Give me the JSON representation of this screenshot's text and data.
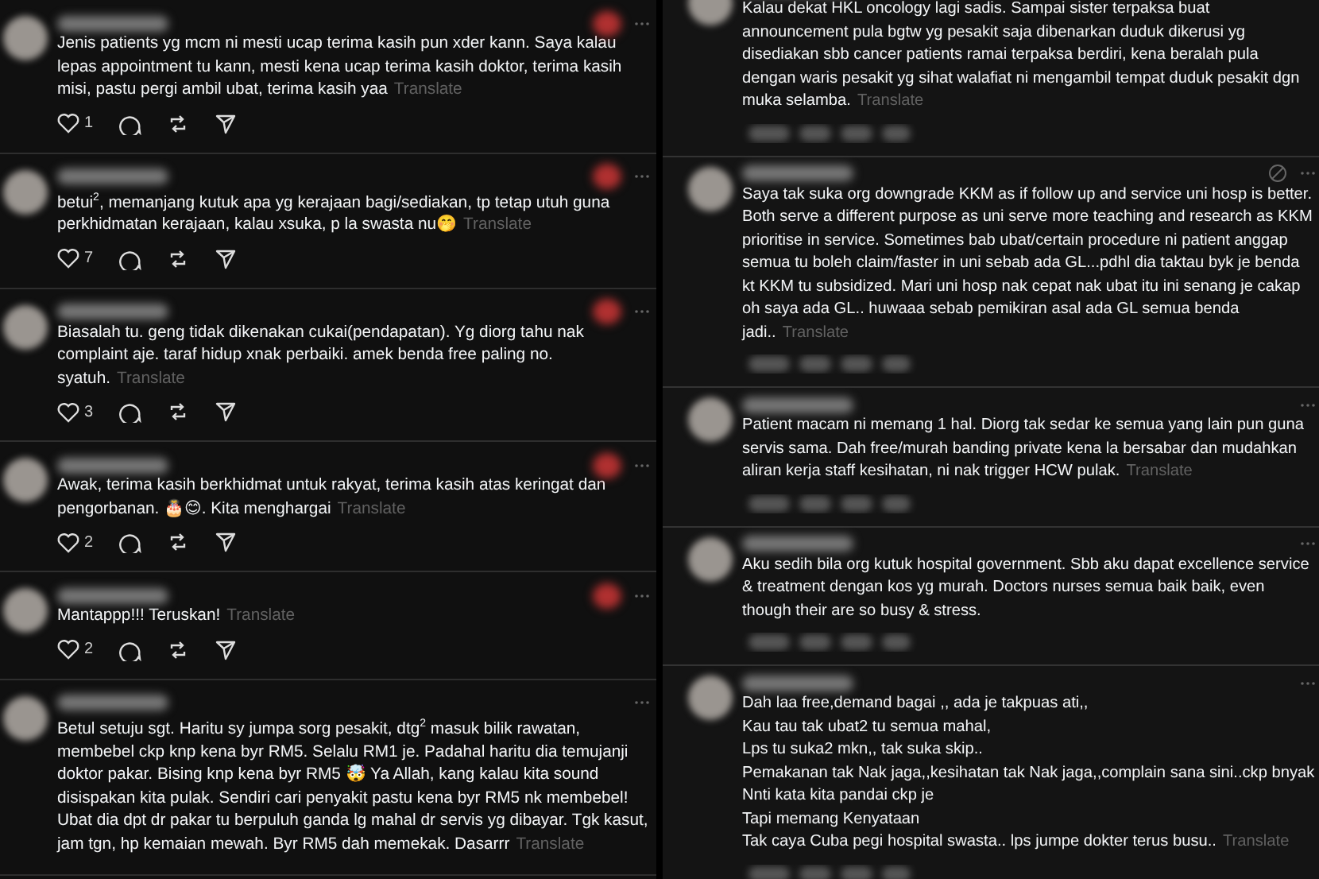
{
  "left_replies": [
    {
      "text": "Jenis patients yg mcm ni mesti ucap terima kasih pun xder kann. Saya kalau lepas appointment tu kann, mesti kena ucap terima kasih doktor, terima kasih misi, pastu pergi ambil ubat, terima kasih yaa",
      "translate": "Translate",
      "likes": "1",
      "author_liked": true
    },
    {
      "text": "betui$^{2}$, memanjang kutuk apa yg kerajaan bagi/sediakan, tp tetap utuh guna perkhidmatan kerajaan, kalau xsuka, p la swasta nu🤭",
      "translate": "Translate",
      "likes": "7",
      "author_liked": true
    },
    {
      "text": "Biasalah tu. geng tidak dikenakan cukai(pendapatan). Yg diorg tahu nak complaint aje. taraf hidup xnak perbaiki. amek benda free paling no. syatuh.",
      "translate": "Translate",
      "likes": "3",
      "author_liked": true
    },
    {
      "text": "Awak, terima kasih berkhidmat untuk rakyat, terima kasih atas keringat dan pengorbanan. 🎂😊. Kita menghargai",
      "translate": "Translate",
      "likes": "2",
      "author_liked": true
    },
    {
      "text": "Mantappp!!! Teruskan!",
      "translate": "Translate",
      "likes": "2",
      "author_liked": true
    },
    {
      "text": "Betul setuju sgt. Haritu sy jumpa sorg pesakit, dtg$^{2}$ masuk bilik rawatan, membebel ckp knp kena byr RM5. Selalu RM1 je. Padahal haritu dia temujanji doktor pakar. Bising knp kena byr RM5 🤯 Ya Allah, kang kalau kita sound disispakan kita pulak. Sendiri cari penyakit pastu kena byr RM5 nk membebel! Ubat dia dpt dr pakar tu berpuluh ganda lg mahal dr servis yg dibayar. Tgk kasut, jam tgn, hp kemaian mewah. Byr RM5 dah memekak. Dasarrr",
      "translate": "Translate",
      "author_liked": false
    }
  ],
  "right_replies": [
    {
      "text": "Kalau dekat HKL oncology lagi sadis. Sampai sister terpaksa buat announcement pula bgtw yg pesakit saja dibenarkan duduk dikerusi yg disediakan sbb cancer patients ramai terpaksa berdiri, kena beralah pula dengan waris pesakit yg sihat walafiat ni mengambil tempat duduk pesakit dgn muka selamba.",
      "translate": "Translate",
      "hidden": false
    },
    {
      "text": "Saya tak suka org downgrade KKM as if follow up and service uni hosp is better. Both serve a different purpose as uni serve more teaching and research as KKM prioritise in service. Sometimes bab ubat/certain procedure ni patient anggap semua tu boleh claim/faster in uni sebab ada GL...pdhl dia taktau byk je benda kt KKM tu subsidized. Mari uni hosp nak cepat nak ubat itu ini senang je cakap oh saya ada GL.. huwaaa sebab pemikiran asal ada GL semua benda jadi..",
      "translate": "Translate",
      "hidden": true
    },
    {
      "text": "Patient macam ni memang 1 hal. Diorg tak sedar ke semua yang lain pun guna servis sama. Dah free/murah banding private kena la bersabar dan mudahkan aliran kerja staff kesihatan, ni nak trigger HCW pulak.",
      "translate": "Translate",
      "hidden": false
    },
    {
      "text": "Aku sedih bila org kutuk hospital government. Sbb aku dapat excellence service & treatment dengan kos yg murah. Doctors nurses semua baik baik, even though their are so busy & stress.",
      "hidden": false
    },
    {
      "text": "Dah laa free,demand bagai ,, ada je takpuas ati,,\nKau tau tak ubat2 tu semua mahal,\nLps tu suka2 mkn,, tak suka skip..\nPemakanan tak Nak jaga,,kesihatan tak Nak jaga,,complain sana sini..ckp bnyak\nNnti kata kita pandai ckp je\nTapi memang Kenyataan\nTak caya Cuba pegi hospital swasta.. lps jumpe dokter terus busu..",
      "translate": "Translate",
      "hidden": false
    }
  ]
}
